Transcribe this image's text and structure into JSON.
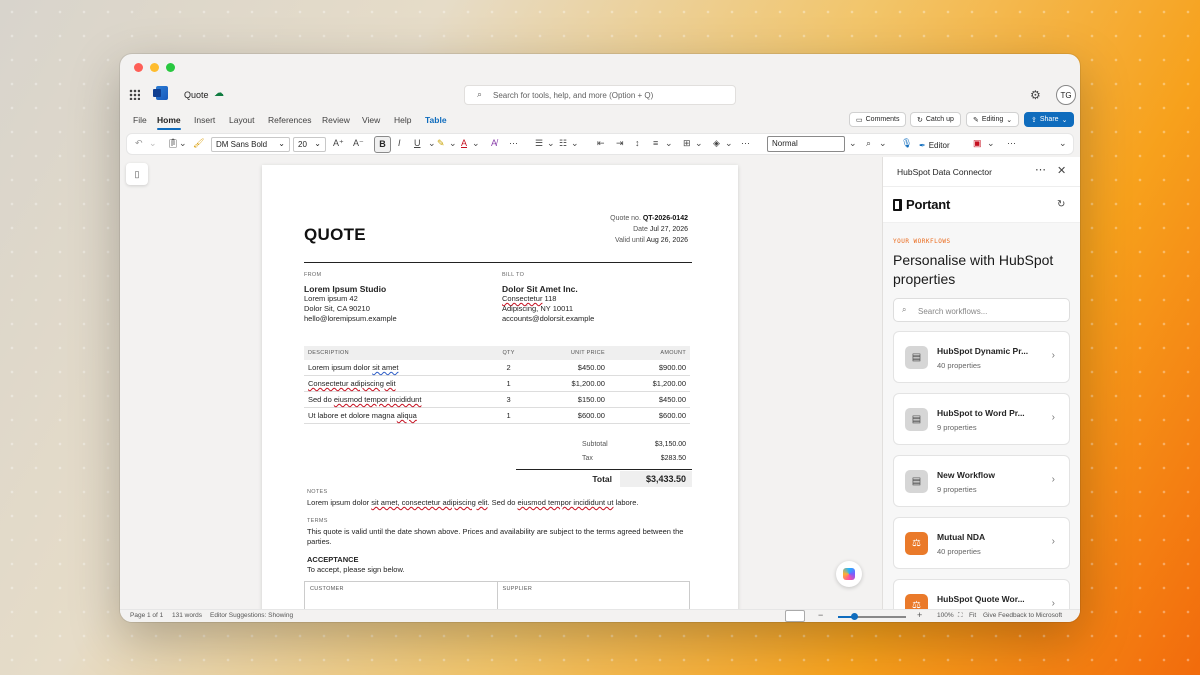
{
  "app": {
    "doc_name": "Quote",
    "search_placeholder": "Search for tools, help, and more (Option + Q)",
    "avatar_initials": "TG"
  },
  "menu": {
    "items": [
      "File",
      "Home",
      "Insert",
      "Layout",
      "References",
      "Review",
      "View",
      "Help",
      "Table"
    ],
    "active": "Home",
    "comments": "Comments",
    "catch_up": "Catch up",
    "editing": "Editing",
    "share": "Share"
  },
  "ribbon": {
    "font": "DM Sans Bold",
    "size": "20",
    "style": "Normal",
    "editor": "Editor"
  },
  "quote": {
    "title": "QUOTE",
    "meta": {
      "quote_no_label": "Quote no.",
      "quote_no": "QT-2026-0142",
      "date_label": "Date",
      "date": "Jul 27, 2026",
      "valid_label": "Valid until",
      "valid": "Aug 26, 2026"
    },
    "from": {
      "label": "FROM",
      "name": "Lorem Ipsum Studio",
      "line1": "Lorem ipsum 42",
      "line2": "Dolor Sit, CA 90210",
      "email": "hello@loremipsum.example"
    },
    "bill_to": {
      "label": "BILL TO",
      "name": "Dolor Sit Amet Inc.",
      "line1_a": "Consectetur",
      "line1_b": " 118",
      "line2": "Adipiscing, NY 10011",
      "email": "accounts@dolorsit.example"
    },
    "table": {
      "headers": [
        "DESCRIPTION",
        "QTY",
        "UNIT PRICE",
        "AMOUNT"
      ],
      "rows": [
        {
          "desc_a": "Lorem ipsum dolor ",
          "desc_sq": "sit amet",
          "desc_b": "",
          "qty": "2",
          "unit": "$450.00",
          "amount": "$900.00"
        },
        {
          "desc_a": "",
          "desc_sq": "Consectetur adipiscing elit",
          "desc_b": "",
          "qty": "1",
          "unit": "$1,200.00",
          "amount": "$1,200.00"
        },
        {
          "desc_a": "Sed do ",
          "desc_sq": "eiusmod tempor incididunt",
          "desc_b": "",
          "qty": "3",
          "unit": "$150.00",
          "amount": "$450.00"
        },
        {
          "desc_a": "Ut labore et dolore magna ",
          "desc_sq": "aliqua",
          "desc_b": "",
          "qty": "1",
          "unit": "$600.00",
          "amount": "$600.00"
        }
      ]
    },
    "totals": {
      "subtotal_label": "Subtotal",
      "subtotal": "$3,150.00",
      "tax_label": "Tax",
      "tax": "$283.50",
      "total_label": "Total",
      "total": "$3,433.50"
    },
    "notes": {
      "label": "NOTES",
      "a": "Lorem ipsum dolor ",
      "sq1": "sit amet, consectetur adipiscing elit",
      "b": ". Sed do ",
      "sq2": "eiusmod tempor incididunt ut",
      "c": " labore."
    },
    "terms": {
      "label": "TERMS",
      "text": "This quote is valid until the date shown above. Prices and availability are subject to the terms agreed between the parties."
    },
    "acceptance": {
      "heading": "ACCEPTANCE",
      "text": "To accept, please sign below."
    },
    "sign": {
      "customer": "CUSTOMER",
      "supplier": "SUPPLIER"
    }
  },
  "pane": {
    "title": "HubSpot Data Connector",
    "brand": "Portant",
    "eyebrow": "YOUR WORKFLOWS",
    "heading": "Personalise with HubSpot properties",
    "search_placeholder": "Search workflows...",
    "workflows": [
      {
        "name": "HubSpot Dynamic Pr...",
        "props": "40 properties",
        "icon": "document-icon"
      },
      {
        "name": "HubSpot to Word Pr...",
        "props": "9 properties",
        "icon": "document-icon"
      },
      {
        "name": "New Workflow",
        "props": "9 properties",
        "icon": "document-icon"
      },
      {
        "name": "Mutual NDA",
        "props": "40 properties",
        "icon": "scales-icon"
      },
      {
        "name": "HubSpot Quote Wor...",
        "props": "",
        "icon": "scales-icon"
      }
    ]
  },
  "status": {
    "page": "Page 1 of 1",
    "words": "131 words",
    "editor": "Editor Suggestions: Showing",
    "zoom": "100%",
    "fit": "Fit",
    "feedback": "Give Feedback to Microsoft"
  }
}
